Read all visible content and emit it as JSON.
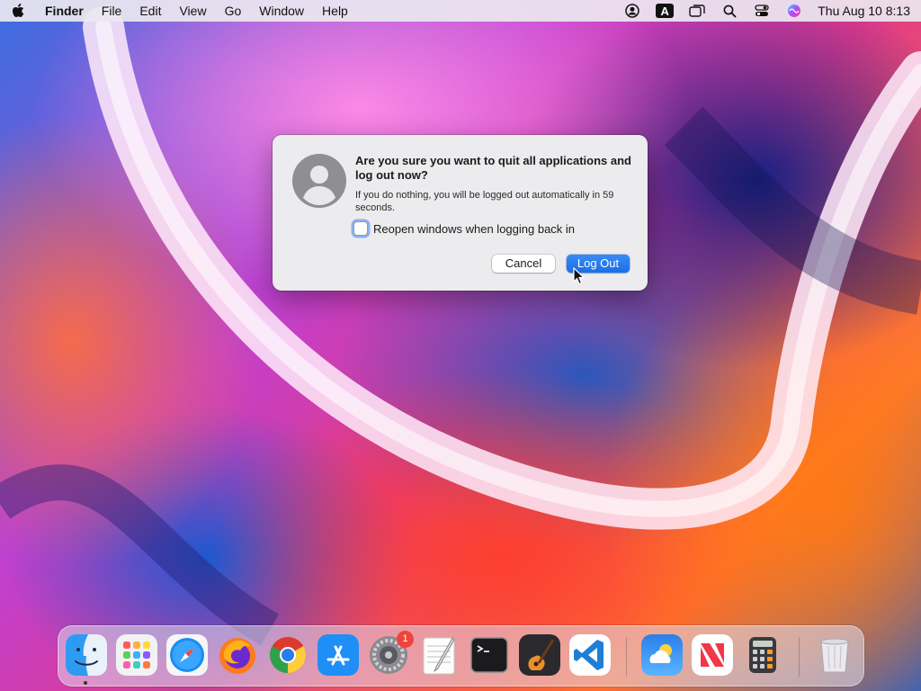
{
  "menubar": {
    "app_name": "Finder",
    "items": [
      "File",
      "Edit",
      "View",
      "Go",
      "Window",
      "Help"
    ],
    "input_source": "A",
    "clock": "Thu Aug 10  8:13"
  },
  "dialog": {
    "title": "Are you sure you want to quit all applications and log out now?",
    "message": "If you do nothing, you will be logged out automatically in 59 seconds.",
    "checkbox_label": "Reopen windows when logging back in",
    "checkbox_checked": false,
    "cancel_label": "Cancel",
    "logout_label": "Log Out"
  },
  "dock": {
    "apps": [
      "finder",
      "launchpad",
      "safari",
      "firefox",
      "chrome",
      "app-store",
      "system-preferences",
      "textedit",
      "terminal",
      "garageband",
      "vscode",
      "weather",
      "news",
      "calculator",
      "trash"
    ],
    "system_preferences_badge": "1"
  },
  "colors": {
    "accent": "#1a6ee8",
    "badge": "#f0443a"
  }
}
